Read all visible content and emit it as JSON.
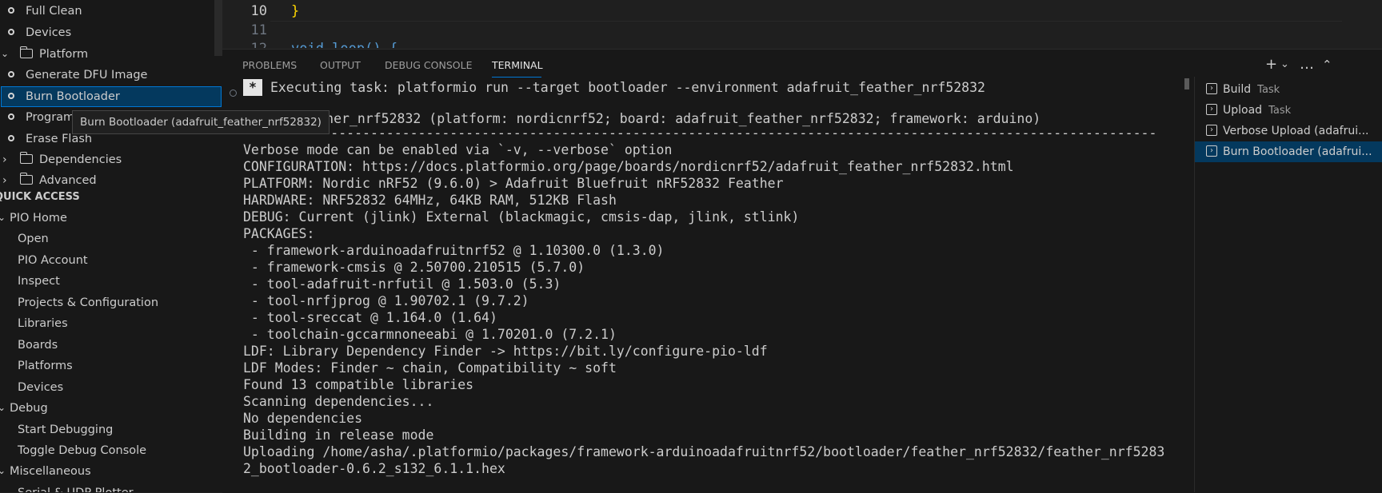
{
  "sidebar": {
    "project_tasks": [
      {
        "label": "Full Clean",
        "kind": "task"
      },
      {
        "label": "Devices",
        "kind": "task"
      },
      {
        "label": "Platform",
        "kind": "folder"
      },
      {
        "label": "Generate DFU Image",
        "kind": "task"
      },
      {
        "label": "Burn Bootloader",
        "kind": "task",
        "selected": true
      },
      {
        "label": "Program",
        "kind": "task"
      },
      {
        "label": "Erase Flash",
        "kind": "task"
      },
      {
        "label": "Dependencies",
        "kind": "folder"
      },
      {
        "label": "Advanced",
        "kind": "folder"
      }
    ],
    "quick_access_title": "QUICK ACCESS",
    "quick_access": [
      {
        "label": "PIO Home",
        "kind": "group"
      },
      {
        "label": "Open"
      },
      {
        "label": "PIO Account"
      },
      {
        "label": "Inspect"
      },
      {
        "label": "Projects & Configuration"
      },
      {
        "label": "Libraries"
      },
      {
        "label": "Boards"
      },
      {
        "label": "Platforms"
      },
      {
        "label": "Devices"
      },
      {
        "label": "Debug",
        "kind": "group"
      },
      {
        "label": "Start Debugging"
      },
      {
        "label": "Toggle Debug Console"
      },
      {
        "label": "Miscellaneous",
        "kind": "group"
      },
      {
        "label": "Serial & UDP Plotter"
      }
    ],
    "tooltip": "Burn Bootloader (adafruit_feather_nrf52832)"
  },
  "editor": {
    "lines": [
      {
        "num": "10",
        "code": "}"
      },
      {
        "num": "11",
        "code": ""
      },
      {
        "num": "12",
        "code": "void loop() {"
      }
    ]
  },
  "panel": {
    "tabs": [
      "PROBLEMS",
      "OUTPUT",
      "DEBUG CONSOLE",
      "TERMINAL"
    ],
    "active_tab": "TERMINAL",
    "actions": [
      "+",
      "⌄",
      "…",
      "⌃"
    ],
    "terminal": {
      "star": "*",
      "executing": "Executing task: platformio run --target bootloader --environment adafruit_feather_nrf52832",
      "env_name": "adafruit_feather_nrf52832",
      "env_rest": " (platform: nordicnrf52; board: adafruit_feather_nrf52832; framework: arduino)",
      "separator": "-------------------------------------------------------------------------------------------------------------------",
      "lines": [
        "Verbose mode can be enabled via `-v, --verbose` option",
        "CONFIGURATION: https://docs.platformio.org/page/boards/nordicnrf52/adafruit_feather_nrf52832.html",
        "PLATFORM: Nordic nRF52 (9.6.0) > Adafruit Bluefruit nRF52832 Feather",
        "HARDWARE: NRF52832 64MHz, 64KB RAM, 512KB Flash",
        "DEBUG: Current (jlink) External (blackmagic, cmsis-dap, jlink, stlink)",
        "PACKAGES:",
        " - framework-arduinoadafruitnrf52 @ 1.10300.0 (1.3.0)",
        " - framework-cmsis @ 2.50700.210515 (5.7.0)",
        " - tool-adafruit-nrfutil @ 1.503.0 (5.3)",
        " - tool-nrfjprog @ 1.90702.1 (9.7.2)",
        " - tool-sreccat @ 1.164.0 (1.64)",
        " - toolchain-gccarmnoneeabi @ 1.70201.0 (7.2.1)",
        "LDF: Library Dependency Finder -> https://bit.ly/configure-pio-ldf",
        "LDF Modes: Finder ~ chain, Compatibility ~ soft",
        "Found 13 compatible libraries",
        "Scanning dependencies...",
        "No dependencies",
        "Building in release mode",
        "Uploading /home/asha/.platformio/packages/framework-arduinoadafruitnrf52/bootloader/feather_nrf52832/feather_nrf5283",
        "2_bootloader-0.6.2_s132_6.1.1.hex"
      ]
    }
  },
  "tasks_list": [
    {
      "name": "Build",
      "type": "Task"
    },
    {
      "name": "Upload",
      "type": "Task"
    },
    {
      "name": "Verbose Upload (adafrui...",
      "type": ""
    },
    {
      "name": "Burn Bootloader (adafrui...",
      "type": "",
      "selected": true
    }
  ],
  "colors": {
    "accent": "#0078d4",
    "selection": "#04395e",
    "brace": "#ffd700",
    "keyword": "#569cd6",
    "function": "#dcdcaa",
    "link": "#3b8eea"
  }
}
